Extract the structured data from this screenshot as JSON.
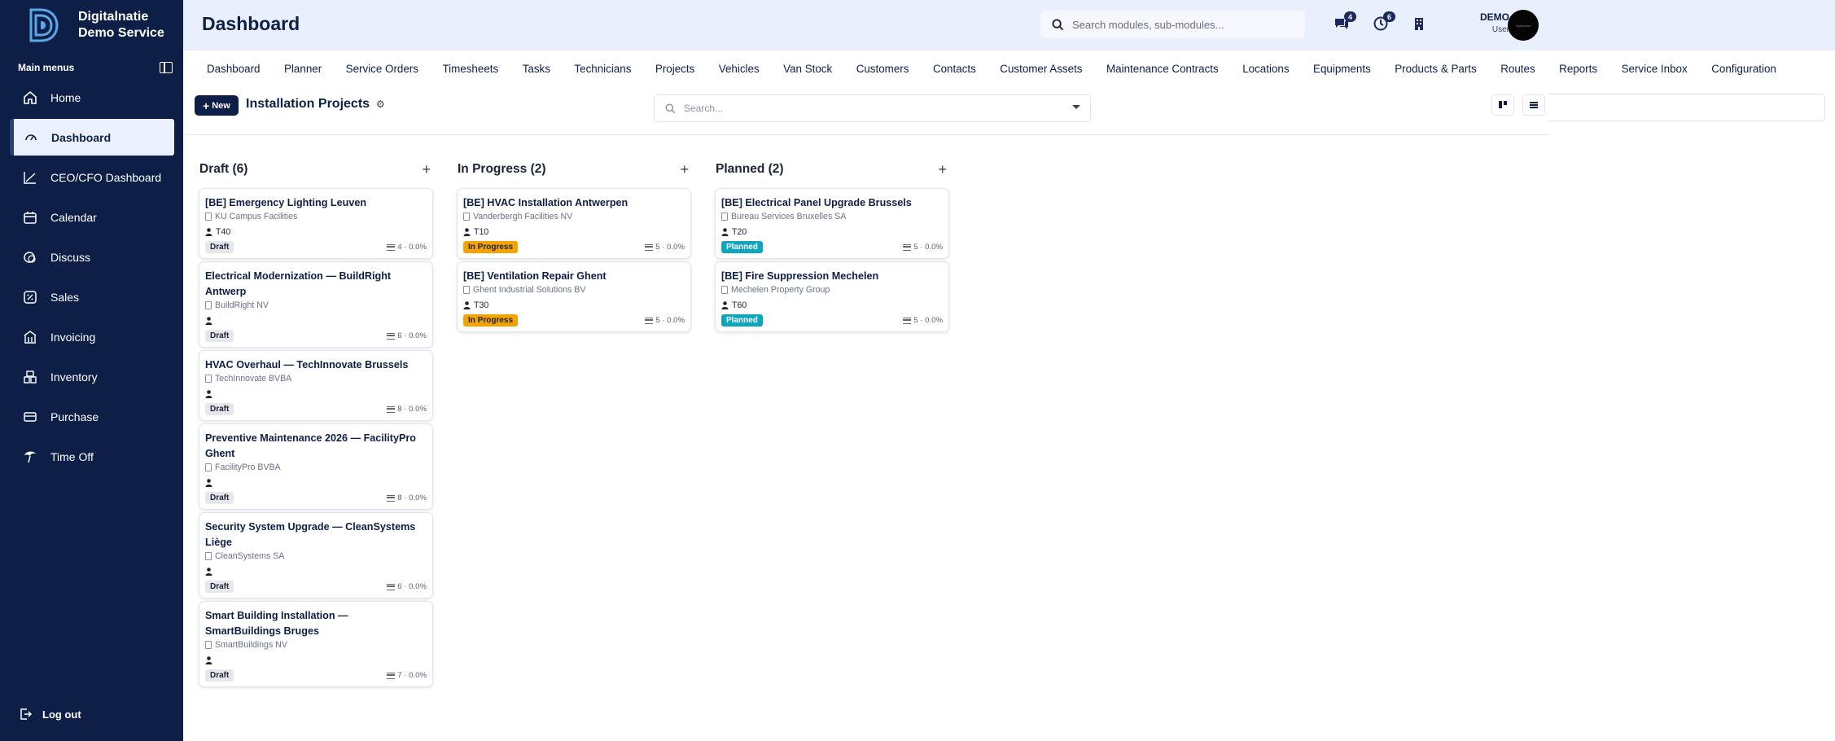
{
  "brand": {
    "line1": "Digitalnatie",
    "line2": "Demo Service"
  },
  "sidebar": {
    "section_label": "Main menus",
    "items": [
      {
        "label": "Home",
        "icon": "home-icon"
      },
      {
        "label": "Dashboard",
        "icon": "gauge-icon",
        "active": true
      },
      {
        "label": "CEO/CFO Dashboard",
        "icon": "chart-line-icon"
      },
      {
        "label": "Calendar",
        "icon": "calendar-icon"
      },
      {
        "label": "Discuss",
        "icon": "chat-icon"
      },
      {
        "label": "Sales",
        "icon": "sales-icon"
      },
      {
        "label": "Invoicing",
        "icon": "invoice-icon"
      },
      {
        "label": "Inventory",
        "icon": "inventory-icon"
      },
      {
        "label": "Purchase",
        "icon": "purchase-icon"
      },
      {
        "label": "Time Off",
        "icon": "palm-icon"
      }
    ],
    "logout_label": "Log out"
  },
  "header": {
    "title": "Dashboard",
    "search_placeholder": "Search modules, sub-modules...",
    "messages_count": "4",
    "activities_count": "6",
    "user_name": "DEMO",
    "user_role": "User",
    "avatar_text": "digitalnatie"
  },
  "modules": [
    "Dashboard",
    "Planner",
    "Service Orders",
    "Timesheets",
    "Tasks",
    "Technicians",
    "Projects",
    "Vehicles",
    "Van Stock",
    "Customers",
    "Contacts",
    "Customer Assets",
    "Maintenance Contracts",
    "Locations",
    "Equipments",
    "Products & Parts",
    "Routes",
    "Reports",
    "Service Inbox",
    "Configuration"
  ],
  "toolbar": {
    "new_label": "New",
    "view_title": "Installation Projects",
    "search_placeholder": "Search..."
  },
  "kanban": {
    "columns": [
      {
        "title": "Draft (6)",
        "cards": [
          {
            "title": "[BE] Emergency Lighting Leuven",
            "company": "KU Campus Facilities",
            "tech": "T40",
            "status": "Draft",
            "meta": "4 · 0.0%"
          },
          {
            "title": "Electrical Modernization — BuildRight Antwerp",
            "company": "BuildRight NV",
            "tech": "",
            "status": "Draft",
            "meta": "6 · 0.0%"
          },
          {
            "title": "HVAC Overhaul — TechInnovate Brussels",
            "company": "TechInnovate BVBA",
            "tech": "",
            "status": "Draft",
            "meta": "8 · 0.0%"
          },
          {
            "title": "Preventive Maintenance 2026 — FacilityPro Ghent",
            "company": "FacilityPro BVBA",
            "tech": "",
            "status": "Draft",
            "meta": "8 · 0.0%"
          },
          {
            "title": "Security System Upgrade — CleanSystems Liège",
            "company": "CleanSystems SA",
            "tech": "",
            "status": "Draft",
            "meta": "6 · 0.0%"
          },
          {
            "title": "Smart Building Installation — SmartBuildings Bruges",
            "company": "SmartBuildings NV",
            "tech": "",
            "status": "Draft",
            "meta": "7 · 0.0%"
          }
        ]
      },
      {
        "title": "In Progress (2)",
        "cards": [
          {
            "title": "[BE] HVAC Installation Antwerpen",
            "company": "Vanderbergh Facilities NV",
            "tech": "T10",
            "status": "In Progress",
            "meta": "5 · 0.0%"
          },
          {
            "title": "[BE] Ventilation Repair Ghent",
            "company": "Ghent Industrial Solutions BV",
            "tech": "T30",
            "status": "In Progress",
            "meta": "5 · 0.0%"
          }
        ]
      },
      {
        "title": "Planned (2)",
        "cards": [
          {
            "title": "[BE] Electrical Panel Upgrade Brussels",
            "company": "Bureau Services Bruxelles SA",
            "tech": "T20",
            "status": "Planned",
            "meta": "5 · 0.0%"
          },
          {
            "title": "[BE] Fire Suppression Mechelen",
            "company": "Mechelen Property Group",
            "tech": "T60",
            "status": "Planned",
            "meta": "5 · 0.0%"
          }
        ]
      }
    ]
  },
  "colors": {
    "sidebar": "#0e1f47",
    "header": "#e9effd",
    "draft": "#e5e7eb",
    "in_progress": "#f5a300",
    "planned": "#0fa5bd"
  }
}
